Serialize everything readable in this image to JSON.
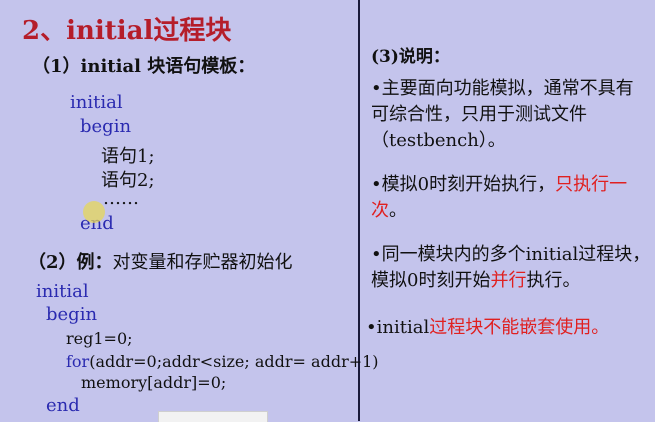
{
  "title": "2、initial过程块",
  "section1": {
    "heading_num": "（1）",
    "heading_text": "initial 块语句模板：",
    "code": {
      "line1": "initial",
      "line2": "begin",
      "line3": "语句1;",
      "line4": "语句2;",
      "line5": "……",
      "line6": "end"
    }
  },
  "section2": {
    "heading": "（2）例：",
    "heading_text": "对变量和存贮器初始化",
    "code": {
      "line1": "initial",
      "line2": "begin",
      "line3": "reg1=0;",
      "line4_kw": "for",
      "line4_rest": "(addr=0;addr<size; addr= addr+1)",
      "line5": "memory[addr]=0;",
      "line6": "end"
    }
  },
  "section3": {
    "heading": "(3)说明：",
    "bullet1": "•主要面向功能模拟，通常不具有可综合性，只用于测试文件（testbench）。",
    "bullet2_prefix": "•模拟0时刻开始执行，",
    "bullet2_red": "只执行一次",
    "bullet2_suffix": "。",
    "bullet3_prefix": "•同一模块内的多个initial过程块，模拟0时刻开始",
    "bullet3_red": "并行",
    "bullet3_suffix": "执行。",
    "bullet4_prefix": "•initial",
    "bullet4_red": "过程块不能嵌套使用。"
  },
  "colors": {
    "background": "#c4c4ec",
    "title": "#b51d2a",
    "code_keyword": "#2a2ab0",
    "highlight": "#e02020"
  }
}
